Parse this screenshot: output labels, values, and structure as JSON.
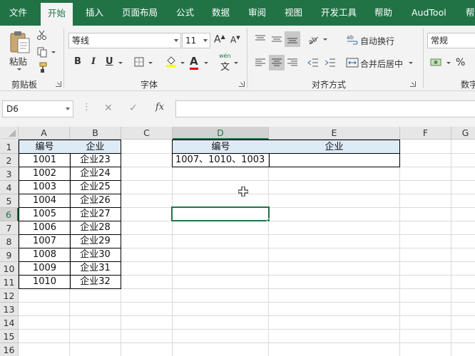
{
  "ribbon_tabs": [
    "文件",
    "开始",
    "插入",
    "页面布局",
    "公式",
    "数据",
    "审阅",
    "视图",
    "开发工具",
    "帮助",
    "AudTool",
    "帮"
  ],
  "active_tab": "开始",
  "clipboard": {
    "paste_label": "粘贴",
    "group_label": "剪贴板"
  },
  "font": {
    "name": "等线",
    "size": "11",
    "grow_label": "A",
    "shrink_label": "A",
    "bold": "B",
    "italic": "I",
    "underline": "U",
    "font_color_label": "A",
    "phonetic_label": "wén",
    "phonetic_char": "文",
    "group_label": "字体"
  },
  "alignment": {
    "wrap_text": "自动换行",
    "merge_center": "合并后居中",
    "group_label": "对齐方式"
  },
  "number": {
    "format": "常规",
    "percent": "%",
    "group_label": "数字"
  },
  "formula_bar": {
    "name_box": "D6",
    "cancel": "✕",
    "enter": "✓",
    "fx": "fx",
    "content": ""
  },
  "columns": [
    "A",
    "B",
    "C",
    "D",
    "E",
    "F",
    "G"
  ],
  "rows": [
    "1",
    "2",
    "3",
    "4",
    "5",
    "6",
    "7",
    "8",
    "9",
    "10",
    "11",
    "12",
    "13",
    "14",
    "15",
    "16"
  ],
  "table_left": {
    "headers": [
      "编号",
      "企业"
    ],
    "rows": [
      [
        "1001",
        "企业23"
      ],
      [
        "1002",
        "企业24"
      ],
      [
        "1003",
        "企业25"
      ],
      [
        "1004",
        "企业26"
      ],
      [
        "1005",
        "企业27"
      ],
      [
        "1006",
        "企业28"
      ],
      [
        "1007",
        "企业29"
      ],
      [
        "1008",
        "企业30"
      ],
      [
        "1009",
        "企业31"
      ],
      [
        "1010",
        "企业32"
      ]
    ]
  },
  "table_right": {
    "headers": [
      "编号",
      "企业"
    ],
    "row": [
      "1007、1010、1003",
      ""
    ]
  },
  "selected_cell": "D6",
  "colors": {
    "accent": "#217346",
    "header_fill": "#ddebf7",
    "font_red": "#e00000"
  }
}
